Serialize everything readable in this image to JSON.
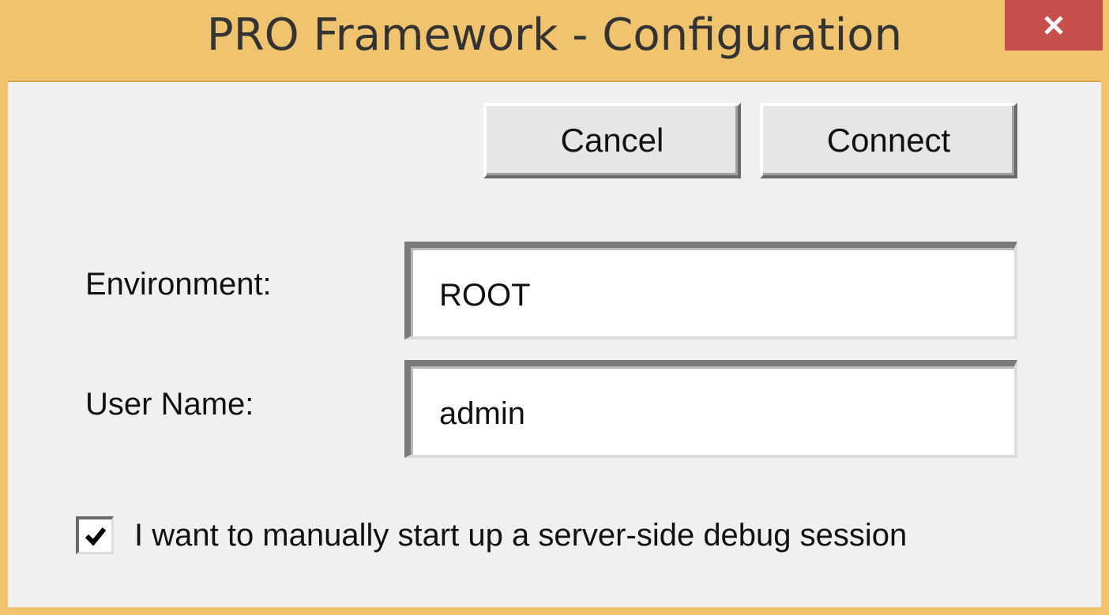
{
  "window": {
    "title": "PRO Framework - Configuration",
    "close_glyph": "x",
    "colors": {
      "frame": "#f0c46e",
      "close": "#c7504f",
      "client": "#f0f0f0"
    }
  },
  "buttons": {
    "cancel_label": "Cancel",
    "connect_label": "Connect"
  },
  "form": {
    "environment": {
      "label": "Environment:",
      "value": "ROOT"
    },
    "user_name": {
      "label": "User Name:",
      "value": "admin"
    },
    "debug_checkbox": {
      "label": "I want to manually start up a server-side debug session",
      "checked": true
    }
  },
  "icons": {
    "close": "close-icon",
    "check": "checkmark-icon"
  }
}
